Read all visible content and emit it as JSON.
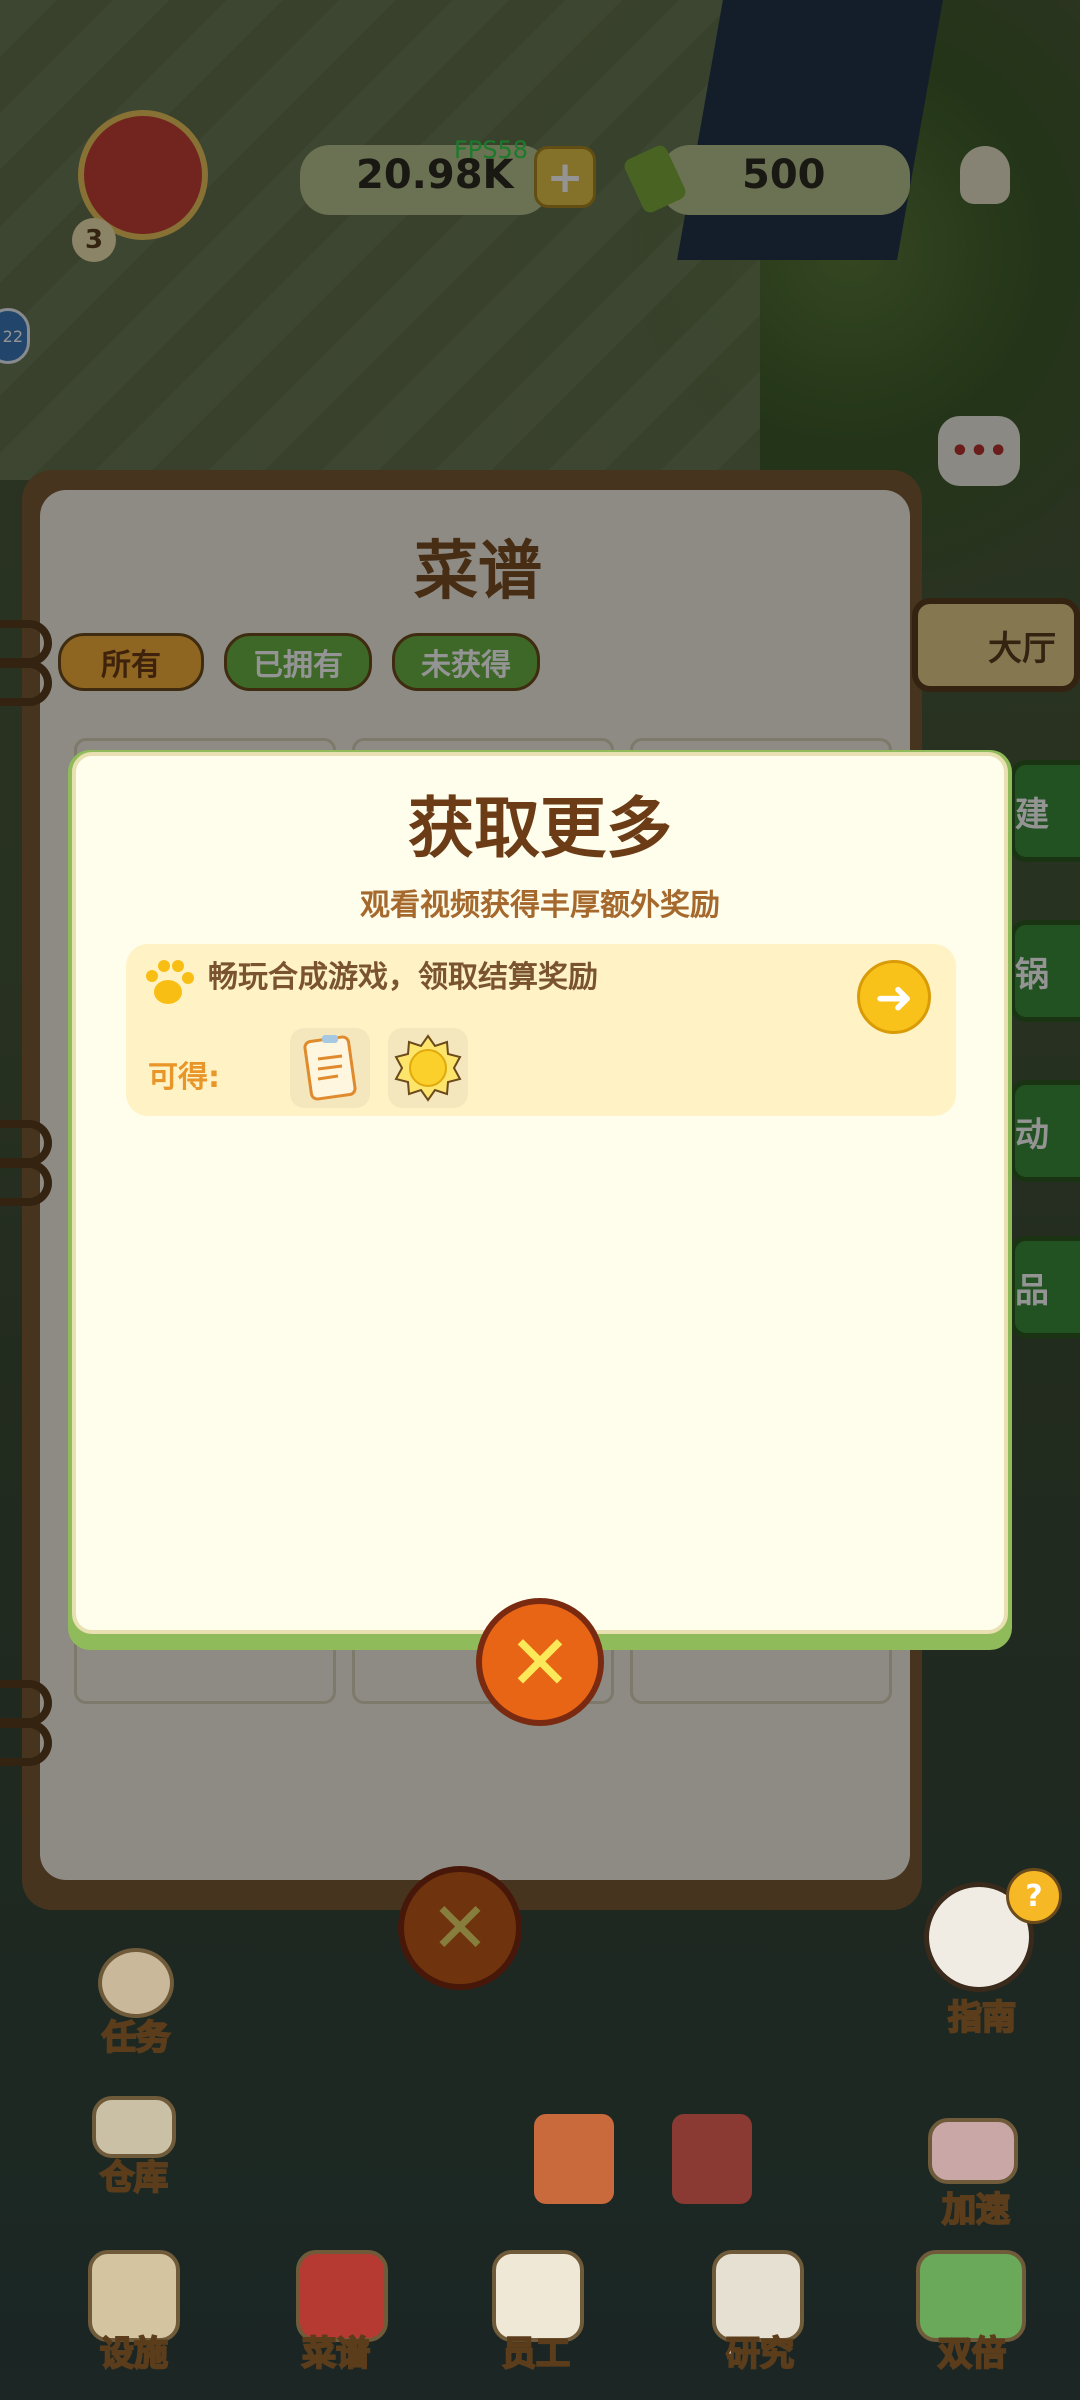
{
  "hud": {
    "fps": "FPS58",
    "coins": "20.98K",
    "bamboo": "500",
    "level": "3",
    "badge": "22"
  },
  "recipe_book": {
    "title": "菜谱",
    "filters": [
      "所有",
      "已拥有",
      "未获得"
    ],
    "side_tabs": [
      "大厅",
      "建",
      "锅",
      "动",
      "品"
    ]
  },
  "modal": {
    "title": "获取更多",
    "subtitle": "观看视频获得丰厚额外奖励",
    "task_text": "畅玩合成游戏，领取结算奖励",
    "reward_label": "可得:",
    "rewards": [
      "recipe-scroll-icon",
      "sun-coin-icon"
    ]
  },
  "side_buttons": {
    "tasks": "任务",
    "warehouse": "仓库",
    "guide": "指南",
    "speedup": "加速"
  },
  "bottom_nav": [
    "设施",
    "菜谱",
    "员工",
    "研究",
    "双倍"
  ],
  "colors": {
    "modal_title": "#6b3c16",
    "subtitle": "#a5692e",
    "reward_label": "#e8962a",
    "close_button": "#e86516",
    "filter_active": "#f4b03a",
    "filter_inactive": "#6bb344"
  }
}
